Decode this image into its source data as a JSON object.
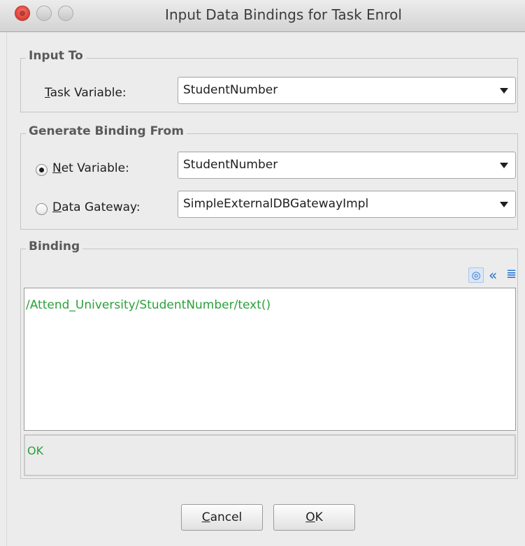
{
  "window": {
    "title": "Input Data Bindings for Task Enrol"
  },
  "input_to": {
    "legend": "Input To",
    "task_variable_mnemonic": "T",
    "task_variable_label_rest": "ask Variable:",
    "task_variable_value": "StudentNumber"
  },
  "generate_from": {
    "legend": "Generate Binding From",
    "net_variable_mnemonic": "N",
    "net_variable_label_rest": "et Variable:",
    "net_variable_value": "StudentNumber",
    "net_variable_selected": true,
    "data_gateway_mnemonic": "D",
    "data_gateway_label_rest": "ata Gateway:",
    "data_gateway_value": "SimpleExternalDBGatewayImpl",
    "data_gateway_selected": false
  },
  "binding": {
    "legend": "Binding",
    "icons": [
      "target-icon",
      "collapse-double-left-icon",
      "align-lines-icon"
    ],
    "expression": "/Attend_University/StudentNumber/text()",
    "status": "OK"
  },
  "buttons": {
    "cancel_mnemonic": "C",
    "cancel_rest": "ancel",
    "ok_mnemonic": "O",
    "ok_rest": "K"
  },
  "colors": {
    "expression_text": "#2aa13a",
    "status_text": "#2aa13a",
    "toolbar_icon": "#1f6fcf",
    "window_bg": "#ececec"
  }
}
